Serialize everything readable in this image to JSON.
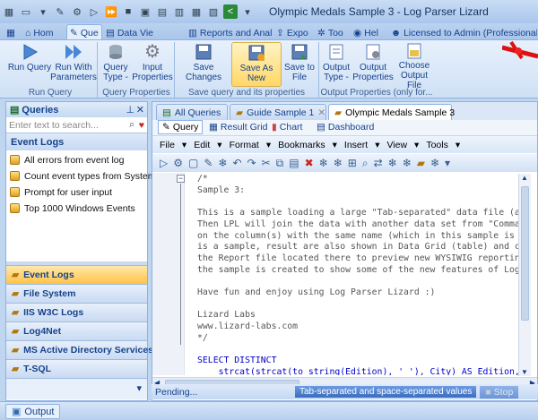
{
  "window": {
    "title": "Olympic Medals Sample 3 - Log Parser Lizard"
  },
  "ribbon_tabs": [
    {
      "label": "Hom"
    },
    {
      "label": "Que"
    },
    {
      "label": "Data Vie"
    },
    {
      "label": "Reports and Analy"
    },
    {
      "label": "Expo"
    },
    {
      "label": "Too"
    },
    {
      "label": "Hel"
    },
    {
      "label": "Licensed to Admin (Professional)"
    }
  ],
  "ribbon": {
    "run_query": "Run Query",
    "run_with": "Run With",
    "parameters": "Parameters",
    "query": "Query",
    "type": "Type -",
    "input": "Input",
    "properties": "Properties",
    "save_changes": "Save Changes",
    "save_as_new": "Save As New",
    "save_to": "Save to",
    "file": "File",
    "output": "Output",
    "output_type": "Type -",
    "output_properties": "Properties",
    "choose": "Choose",
    "output_file": "Output File",
    "group_run": "Run Query",
    "group_props": "Query Properties",
    "group_save": "Save query and its properties",
    "group_output": "Output Properties (only for..."
  },
  "queries_panel": {
    "title": "Queries",
    "search_placeholder": "Enter text to search...",
    "section": "Event Logs",
    "items": [
      {
        "label": "All errors from event log"
      },
      {
        "label": "Count event types from System"
      },
      {
        "label": "Prompt for user input"
      },
      {
        "label": "Top 1000 Windows Events"
      }
    ]
  },
  "nav": [
    {
      "label": "Event Logs"
    },
    {
      "label": "File System"
    },
    {
      "label": "IIS W3C Logs"
    },
    {
      "label": "Log4Net"
    },
    {
      "label": "MS Active Directory Services"
    },
    {
      "label": "T-SQL"
    }
  ],
  "doc_tabs": [
    {
      "label": "All Queries"
    },
    {
      "label": "Guide Sample 1"
    },
    {
      "label": "Olympic Medals Sample 3"
    }
  ],
  "sub_tabs": [
    {
      "label": "Query"
    },
    {
      "label": "Result Grid"
    },
    {
      "label": "Chart"
    },
    {
      "label": "Dashboard"
    }
  ],
  "menu": [
    "File",
    "Edit",
    "Format",
    "Bookmarks",
    "Insert",
    "View",
    "Tools"
  ],
  "code_lines": [
    "/*",
    "Sample 3:",
    "",
    "This is a sample loading a large \"Tab-separated\" data file (a",
    "Then LPL will join the data with another data set from \"Comma",
    "on the column(s) with the same name (which in this sample is",
    "is a sample, result are also shown in Data Grid (table) and c",
    "the Report file located there to preview new WYSIWIG reportin",
    "the sample is created to show some of the new features of Log",
    "",
    "Have fun and enjoy using Log Parser Lizard :)",
    "",
    "Lizard Labs",
    "www.lizard-labs.com",
    "*/",
    "",
    "SELECT DISTINCT",
    "    strcat(strcat(to_string(Edition), ' '), City) AS Edition,"
  ],
  "status": {
    "left": "Pending...",
    "format": "Tab-separated and space-separated values",
    "stop": "Stop"
  },
  "bottom": {
    "output_tab": "Output"
  },
  "colors": {
    "accent": "#15428b",
    "highlight": "#ffd766",
    "keyword": "#0000cc"
  }
}
